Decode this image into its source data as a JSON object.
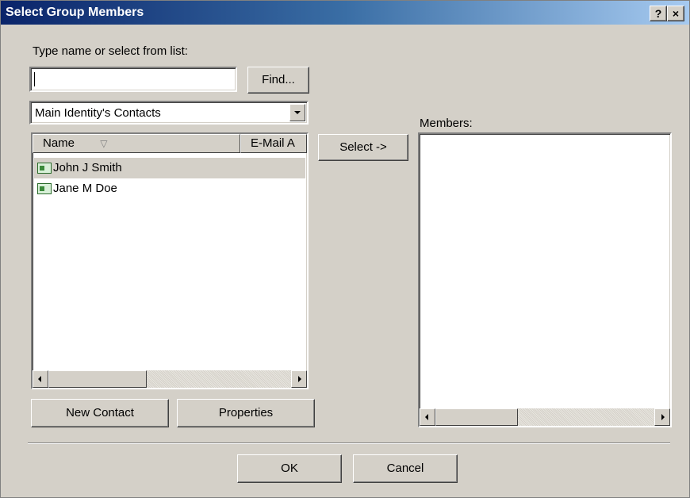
{
  "window": {
    "title": "Select Group Members",
    "help_label": "?",
    "close_label": "×"
  },
  "search": {
    "label": "Type name or select from list:",
    "value": "",
    "find_label": "Find..."
  },
  "address_book": {
    "selected": "Main Identity's Contacts"
  },
  "contacts": {
    "columns": [
      "Name",
      "E-Mail A"
    ],
    "sort_indicator": "▽",
    "rows": [
      {
        "name": "John J Smith",
        "selected": true
      },
      {
        "name": "Jane M Doe",
        "selected": false
      }
    ]
  },
  "select_button": "Select ->",
  "members": {
    "label": "Members:"
  },
  "buttons": {
    "new_contact": "New Contact",
    "properties": "Properties",
    "ok": "OK",
    "cancel": "Cancel"
  },
  "colors": {
    "title_gradient_start": "#0a246a",
    "title_gradient_end": "#a6caf0",
    "dialog_face": "#d4d0c8"
  }
}
